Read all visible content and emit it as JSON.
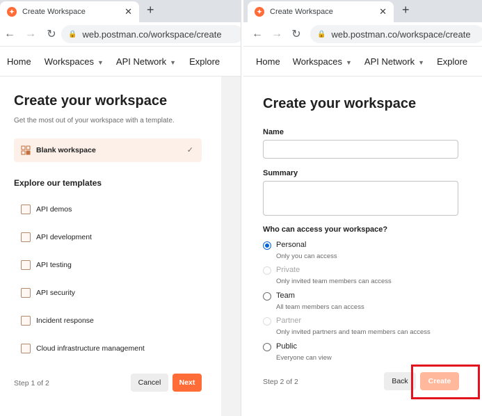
{
  "left": {
    "browser": {
      "tab_title": "Create Workspace",
      "url": "web.postman.co/workspace/create"
    },
    "nav": [
      "Home",
      "Workspaces",
      "API Network",
      "Explore"
    ],
    "title": "Create your workspace",
    "subtitle": "Get the most out of your workspace with a template.",
    "blank_option": "Blank workspace",
    "templates_heading": "Explore our templates",
    "templates": [
      "API demos",
      "API development",
      "API testing",
      "API security",
      "Incident response",
      "Cloud infrastructure management"
    ],
    "step": "Step 1 of 2",
    "cancel_label": "Cancel",
    "next_label": "Next"
  },
  "right": {
    "browser": {
      "tab_title": "Create Workspace",
      "url": "web.postman.co/workspace/create"
    },
    "nav": [
      "Home",
      "Workspaces",
      "API Network",
      "Explore"
    ],
    "title": "Create your workspace",
    "name_label": "Name",
    "name_value": "",
    "summary_label": "Summary",
    "summary_value": "",
    "access_heading": "Who can access your workspace?",
    "access_options": [
      {
        "title": "Personal",
        "desc": "Only you can access",
        "state": "checked"
      },
      {
        "title": "Private",
        "desc": "Only invited team members can access",
        "state": "disabled"
      },
      {
        "title": "Team",
        "desc": "All team members can access",
        "state": "enabled"
      },
      {
        "title": "Partner",
        "desc": "Only invited partners and team members can access",
        "state": "disabled"
      },
      {
        "title": "Public",
        "desc": "Everyone can view",
        "state": "enabled"
      }
    ],
    "step": "Step 2 of 2",
    "back_label": "Back",
    "create_label": "Create"
  },
  "colors": {
    "brand": "#ff6c37",
    "create_disabled": "#ffb89c",
    "radio_selected": "#0265d2",
    "highlight": "#e2131c"
  }
}
